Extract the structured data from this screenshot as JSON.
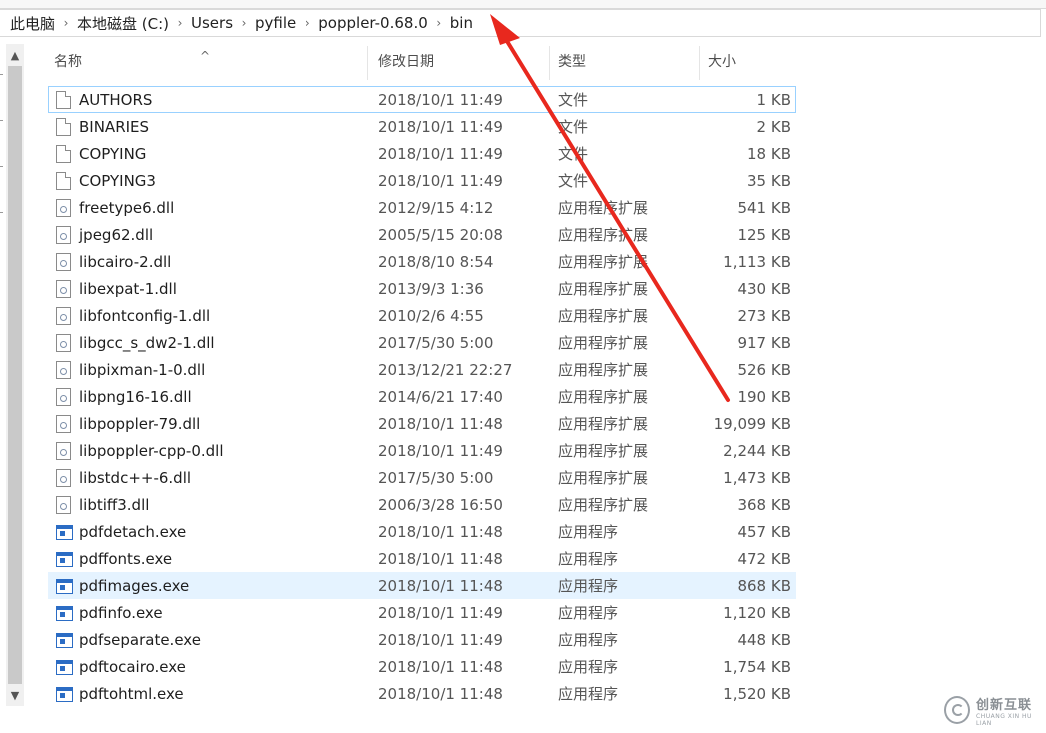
{
  "breadcrumb": [
    "此电脑",
    "本地磁盘 (C:)",
    "Users",
    "pyfile",
    "poppler-0.68.0",
    "bin"
  ],
  "breadcrumb_separator": "›",
  "columns": {
    "name": "名称",
    "date": "修改日期",
    "type": "类型",
    "size": "大小"
  },
  "sort_indicator": "^",
  "scrollbar": {
    "up": "▲",
    "down": "▼"
  },
  "files": [
    {
      "name": "AUTHORS",
      "date": "2018/10/1 11:49",
      "type": "文件",
      "size": "1 KB",
      "icon": "file-icon"
    },
    {
      "name": "BINARIES",
      "date": "2018/10/1 11:49",
      "type": "文件",
      "size": "2 KB",
      "icon": "file-icon"
    },
    {
      "name": "COPYING",
      "date": "2018/10/1 11:49",
      "type": "文件",
      "size": "18 KB",
      "icon": "file-icon"
    },
    {
      "name": "COPYING3",
      "date": "2018/10/1 11:49",
      "type": "文件",
      "size": "35 KB",
      "icon": "file-icon"
    },
    {
      "name": "freetype6.dll",
      "date": "2012/9/15 4:12",
      "type": "应用程序扩展",
      "size": "541 KB",
      "icon": "dll-icon"
    },
    {
      "name": "jpeg62.dll",
      "date": "2005/5/15 20:08",
      "type": "应用程序扩展",
      "size": "125 KB",
      "icon": "dll-icon"
    },
    {
      "name": "libcairo-2.dll",
      "date": "2018/8/10 8:54",
      "type": "应用程序扩展",
      "size": "1,113 KB",
      "icon": "dll-icon"
    },
    {
      "name": "libexpat-1.dll",
      "date": "2013/9/3 1:36",
      "type": "应用程序扩展",
      "size": "430 KB",
      "icon": "dll-icon"
    },
    {
      "name": "libfontconfig-1.dll",
      "date": "2010/2/6 4:55",
      "type": "应用程序扩展",
      "size": "273 KB",
      "icon": "dll-icon"
    },
    {
      "name": "libgcc_s_dw2-1.dll",
      "date": "2017/5/30 5:00",
      "type": "应用程序扩展",
      "size": "917 KB",
      "icon": "dll-icon"
    },
    {
      "name": "libpixman-1-0.dll",
      "date": "2013/12/21 22:27",
      "type": "应用程序扩展",
      "size": "526 KB",
      "icon": "dll-icon"
    },
    {
      "name": "libpng16-16.dll",
      "date": "2014/6/21 17:40",
      "type": "应用程序扩展",
      "size": "190 KB",
      "icon": "dll-icon"
    },
    {
      "name": "libpoppler-79.dll",
      "date": "2018/10/1 11:48",
      "type": "应用程序扩展",
      "size": "19,099 KB",
      "icon": "dll-icon"
    },
    {
      "name": "libpoppler-cpp-0.dll",
      "date": "2018/10/1 11:49",
      "type": "应用程序扩展",
      "size": "2,244 KB",
      "icon": "dll-icon"
    },
    {
      "name": "libstdc++-6.dll",
      "date": "2017/5/30 5:00",
      "type": "应用程序扩展",
      "size": "1,473 KB",
      "icon": "dll-icon"
    },
    {
      "name": "libtiff3.dll",
      "date": "2006/3/28 16:50",
      "type": "应用程序扩展",
      "size": "368 KB",
      "icon": "dll-icon"
    },
    {
      "name": "pdfdetach.exe",
      "date": "2018/10/1 11:48",
      "type": "应用程序",
      "size": "457 KB",
      "icon": "exe-icon"
    },
    {
      "name": "pdffonts.exe",
      "date": "2018/10/1 11:48",
      "type": "应用程序",
      "size": "472 KB",
      "icon": "exe-icon"
    },
    {
      "name": "pdfimages.exe",
      "date": "2018/10/1 11:48",
      "type": "应用程序",
      "size": "868 KB",
      "icon": "exe-icon"
    },
    {
      "name": "pdfinfo.exe",
      "date": "2018/10/1 11:49",
      "type": "应用程序",
      "size": "1,120 KB",
      "icon": "exe-icon"
    },
    {
      "name": "pdfseparate.exe",
      "date": "2018/10/1 11:49",
      "type": "应用程序",
      "size": "448 KB",
      "icon": "exe-icon"
    },
    {
      "name": "pdftocairo.exe",
      "date": "2018/10/1 11:48",
      "type": "应用程序",
      "size": "1,754 KB",
      "icon": "exe-icon"
    },
    {
      "name": "pdftohtml.exe",
      "date": "2018/10/1 11:48",
      "type": "应用程序",
      "size": "1,520 KB",
      "icon": "exe-icon"
    }
  ],
  "focused_file": "AUTHORS",
  "selected_file": "pdfimages.exe",
  "annotation": {
    "type": "red-arrow",
    "points_to": "bin",
    "color": "#e8281e"
  },
  "watermark": {
    "main": "创新互联",
    "sub": "CHUANG XIN HU LIAN"
  },
  "colors": {
    "selection": "#e5f3ff",
    "focus_border": "#99d1ff",
    "exe_blue": "#2b6cc4"
  }
}
